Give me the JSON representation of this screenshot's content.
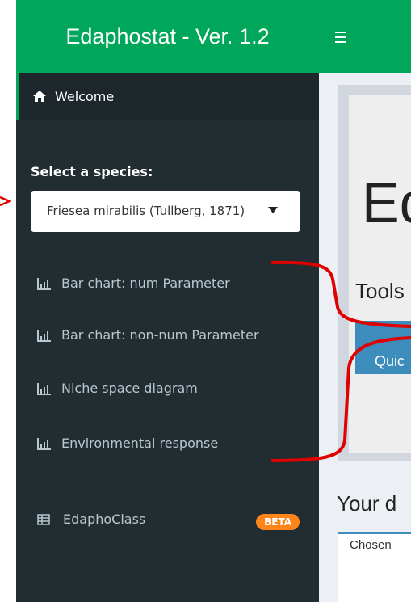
{
  "sidebar": {
    "logo": "Edaphostat - Ver. 1.2",
    "welcome": "Welcome",
    "species_label": "Select a species:",
    "species_selected": "Friesea mirabilis (Tullberg, 1871)",
    "menu": [
      {
        "label": "Bar chart: num Parameter",
        "icon": "bar-chart-icon"
      },
      {
        "label": "Bar chart: non-num Parameter",
        "icon": "bar-chart-icon"
      },
      {
        "label": "Niche space diagram",
        "icon": "bar-chart-icon"
      },
      {
        "label": "Environmental response",
        "icon": "bar-chart-icon"
      }
    ],
    "edaphoclass": {
      "label": "EdaphoClass",
      "badge": "BETA",
      "icon": "table-icon"
    }
  },
  "navbar": {
    "toggle_icon": "hamburger-icon"
  },
  "main": {
    "title_partial": "Ed",
    "tools_partial": "Tools",
    "quick_button": "Quic",
    "section_partial": "Your d",
    "card_text": "Chosen"
  },
  "colors": {
    "brand_green": "#00a65a",
    "sidebar_bg": "#222d32",
    "accent_blue": "#3c8dbc",
    "badge_orange": "#ff851b",
    "annotation_red": "#e00000"
  }
}
